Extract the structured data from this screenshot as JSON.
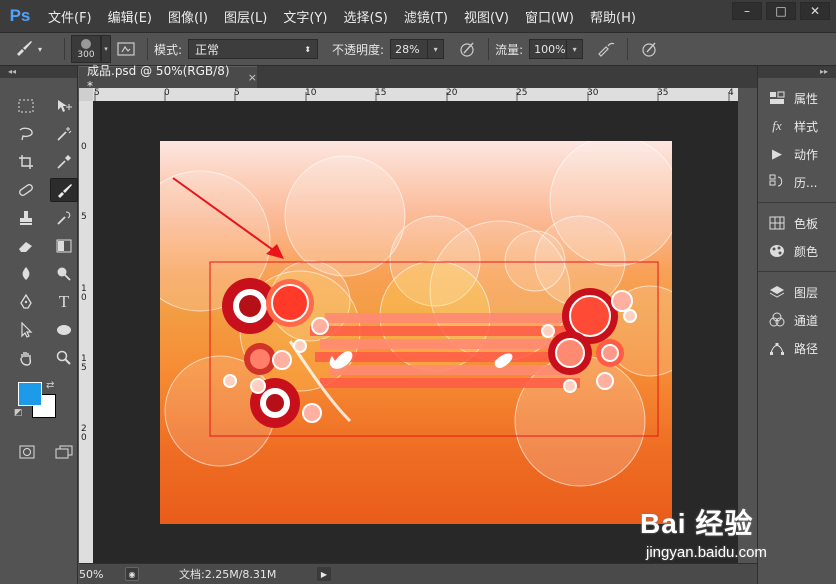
{
  "app": {
    "logo": "Ps"
  },
  "menu": [
    "文件(F)",
    "编辑(E)",
    "图像(I)",
    "图层(L)",
    "文字(Y)",
    "选择(S)",
    "滤镜(T)",
    "视图(V)",
    "窗口(W)",
    "帮助(H)"
  ],
  "window_controls": [
    "–",
    "□",
    "✕"
  ],
  "options": {
    "brush_size": "300",
    "mode_label": "模式:",
    "mode_value": "正常",
    "opacity_label": "不透明度:",
    "opacity_value": "28%",
    "flow_label": "流量:",
    "flow_value": "100%"
  },
  "document": {
    "tab_title": "成品.psd @ 50%(RGB/8) *",
    "close_glyph": "×"
  },
  "rulers": {
    "h_ticks": [
      "5",
      "0",
      "5",
      "10",
      "15",
      "20",
      "25",
      "30",
      "35",
      "4"
    ],
    "v_ticks": [
      "0",
      "5",
      "1 0",
      "1 5",
      "2 0"
    ]
  },
  "status": {
    "zoom": "50%",
    "doc_info": "文档:2.25M/8.31M"
  },
  "panels": {
    "group1": [
      {
        "label": "属性",
        "icon": "properties-icon"
      },
      {
        "label": "样式",
        "icon": "styles-icon"
      },
      {
        "label": "动作",
        "icon": "actions-icon"
      },
      {
        "label": "历...",
        "icon": "history-icon"
      }
    ],
    "group2": [
      {
        "label": "色板",
        "icon": "swatches-icon"
      },
      {
        "label": "颜色",
        "icon": "color-icon"
      }
    ],
    "group3": [
      {
        "label": "图层",
        "icon": "layers-icon"
      },
      {
        "label": "通道",
        "icon": "channels-icon"
      },
      {
        "label": "路径",
        "icon": "paths-icon"
      }
    ]
  },
  "colors": {
    "foreground": "#1e9be8",
    "background": "#ffffff",
    "accent_ps": "#4ea3ff",
    "annotation_red": "#e8131b"
  },
  "watermark": {
    "main": "Bai 经验",
    "sub": "jingyan.baidu.com"
  }
}
